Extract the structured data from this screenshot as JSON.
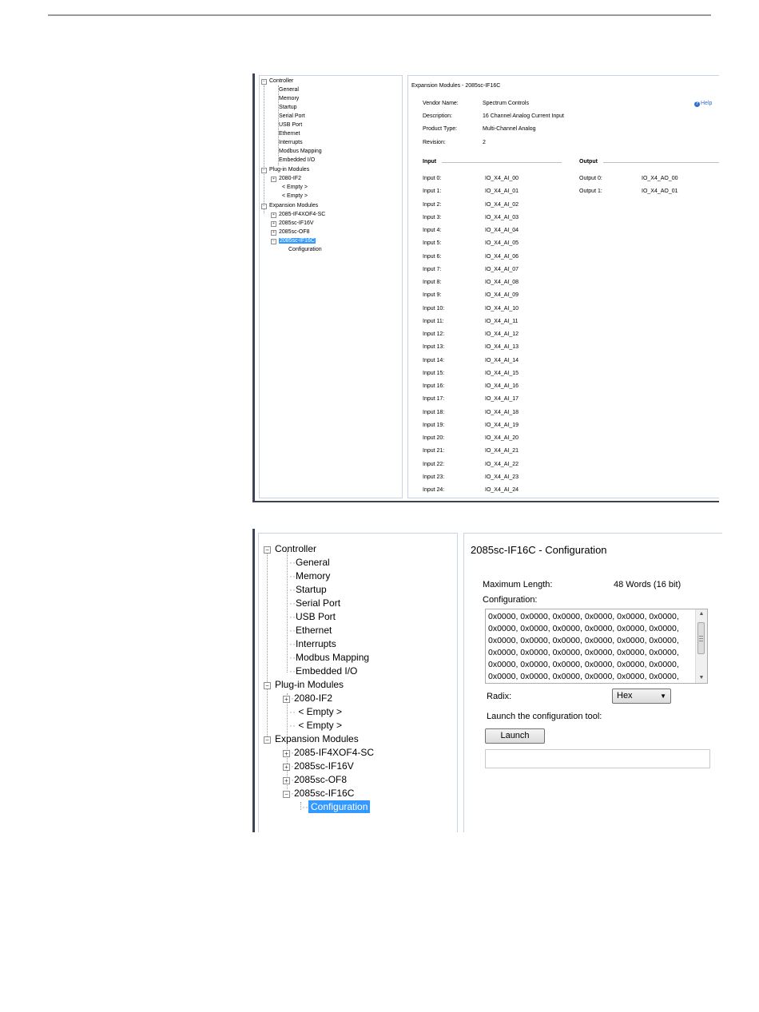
{
  "screen1": {
    "tree": {
      "controller": "Controller",
      "controller_items": [
        "General",
        "Memory",
        "Startup",
        "Serial Port",
        "USB Port",
        "Ethernet",
        "Interrupts",
        "Modbus Mapping",
        "Embedded I/O"
      ],
      "plugin": "Plug-in Modules",
      "plugin_items": [
        "2080-IF2",
        "< Empty >",
        "< Empty >"
      ],
      "expansion": "Expansion Modules",
      "expansion_items": [
        "2085-IF4XOF4-SC",
        "2085sc-IF16V",
        "2085sc-OF8",
        "2085sc-IF16C"
      ],
      "configuration": "Configuration"
    },
    "main": {
      "title": "Expansion Modules - 2085sc-IF16C",
      "help": "Help",
      "vendor_label": "Vendor Name:",
      "vendor_value": "Spectrum Controls",
      "desc_label": "Description:",
      "desc_value": "16 Channel Analog Current Input",
      "type_label": "Product Type:",
      "type_value": "Multi-Channel Analog",
      "rev_label": "Revision:",
      "rev_value": "2",
      "input_header": "Input",
      "output_header": "Output",
      "inputs": [
        {
          "label": "Input 0:",
          "value": "IO_X4_AI_00"
        },
        {
          "label": "Input 1:",
          "value": "IO_X4_AI_01"
        },
        {
          "label": "Input 2:",
          "value": "IO_X4_AI_02"
        },
        {
          "label": "Input 3:",
          "value": "IO_X4_AI_03"
        },
        {
          "label": "Input 4:",
          "value": "IO_X4_AI_04"
        },
        {
          "label": "Input 5:",
          "value": "IO_X4_AI_05"
        },
        {
          "label": "Input 6:",
          "value": "IO_X4_AI_06"
        },
        {
          "label": "Input 7:",
          "value": "IO_X4_AI_07"
        },
        {
          "label": "Input 8:",
          "value": "IO_X4_AI_08"
        },
        {
          "label": "Input 9:",
          "value": "IO_X4_AI_09"
        },
        {
          "label": "Input 10:",
          "value": "IO_X4_AI_10"
        },
        {
          "label": "Input 11:",
          "value": "IO_X4_AI_11"
        },
        {
          "label": "Input 12:",
          "value": "IO_X4_AI_12"
        },
        {
          "label": "Input 13:",
          "value": "IO_X4_AI_13"
        },
        {
          "label": "Input 14:",
          "value": "IO_X4_AI_14"
        },
        {
          "label": "Input 15:",
          "value": "IO_X4_AI_15"
        },
        {
          "label": "Input 16:",
          "value": "IO_X4_AI_16"
        },
        {
          "label": "Input 17:",
          "value": "IO_X4_AI_17"
        },
        {
          "label": "Input 18:",
          "value": "IO_X4_AI_18"
        },
        {
          "label": "Input 19:",
          "value": "IO_X4_AI_19"
        },
        {
          "label": "Input 20:",
          "value": "IO_X4_AI_20"
        },
        {
          "label": "Input 21:",
          "value": "IO_X4_AI_21"
        },
        {
          "label": "Input 22:",
          "value": "IO_X4_AI_22"
        },
        {
          "label": "Input 23:",
          "value": "IO_X4_AI_23"
        },
        {
          "label": "Input 24:",
          "value": "IO_X4_AI_24"
        }
      ],
      "outputs": [
        {
          "label": "Output 0:",
          "value": "IO_X4_AO_00"
        },
        {
          "label": "Output 1:",
          "value": "IO_X4_AO_01"
        }
      ]
    }
  },
  "screen2": {
    "tree": {
      "controller": "Controller",
      "controller_items": [
        "General",
        "Memory",
        "Startup",
        "Serial Port",
        "USB Port",
        "Ethernet",
        "Interrupts",
        "Modbus Mapping",
        "Embedded I/O"
      ],
      "plugin": "Plug-in Modules",
      "plugin_items": [
        "2080-IF2",
        "< Empty >",
        "< Empty >"
      ],
      "expansion": "Expansion Modules",
      "expansion_items": [
        "2085-IF4XOF4-SC",
        "2085sc-IF16V",
        "2085sc-OF8",
        "2085sc-IF16C"
      ],
      "configuration": "Configuration"
    },
    "main": {
      "title": "2085sc-IF16C - Configuration",
      "max_length_label": "Maximum Length:",
      "max_length_value": "48  Words (16 bit)",
      "configuration_label": "Configuration:",
      "config_lines": [
        "0x0000, 0x0000, 0x0000, 0x0000, 0x0000, 0x0000,",
        "0x0000, 0x0000, 0x0000, 0x0000, 0x0000, 0x0000,",
        "0x0000, 0x0000, 0x0000, 0x0000, 0x0000, 0x0000,",
        "0x0000, 0x0000, 0x0000, 0x0000, 0x0000, 0x0000,",
        "0x0000, 0x0000, 0x0000, 0x0000, 0x0000, 0x0000,",
        "0x0000, 0x0000, 0x0000, 0x0000, 0x0000, 0x0000,"
      ],
      "radix_label": "Radix:",
      "radix_value": "Hex",
      "launch_label": "Launch the configuration tool:",
      "launch_button": "Launch"
    }
  }
}
